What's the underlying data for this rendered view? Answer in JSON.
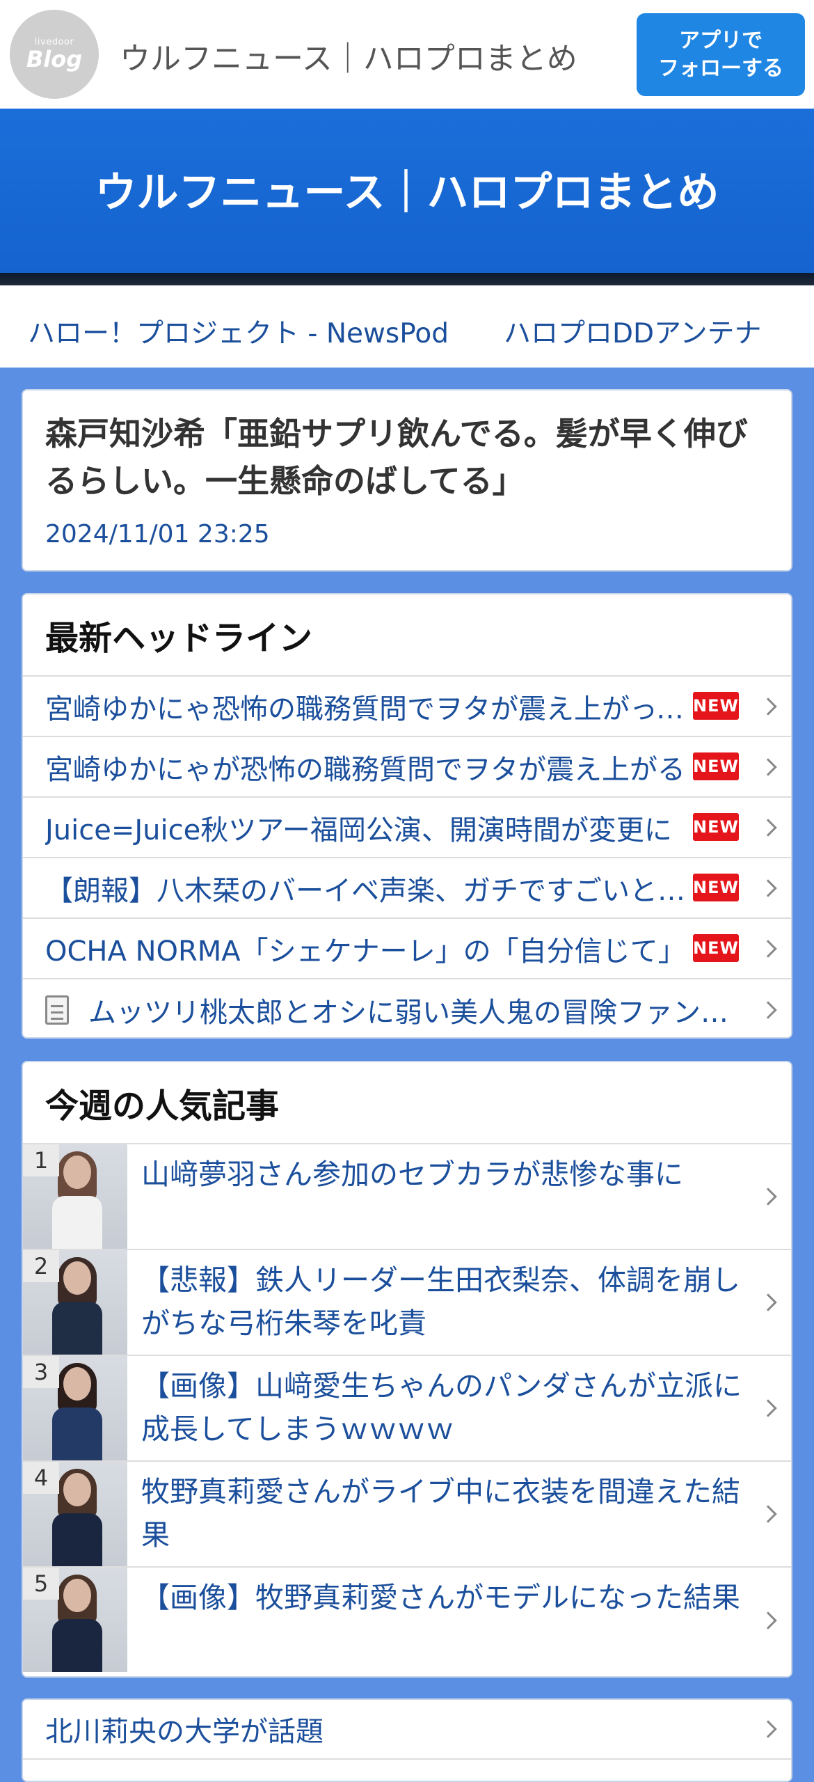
{
  "header": {
    "logo_small": "livedoor",
    "logo_big": "Blog",
    "title": "ウルフニュース｜ハロプロまとめ",
    "follow_line1": "アプリで",
    "follow_line2": "フォローする"
  },
  "hero": {
    "title": "ウルフニュース｜ハロプロまとめ"
  },
  "links": [
    {
      "label": "ハロー！プロジェクト - NewsPod"
    },
    {
      "label": "ハロプロDDアンテナ"
    }
  ],
  "article": {
    "title": "森戸知沙希「亜鉛サプリ飲んでる。髪が早く伸びるらしい。一生懸命のばしてる」",
    "date": "2024/11/01 23:25"
  },
  "headlines": {
    "heading": "最新ヘッドライン",
    "new_label": "NEW",
    "items": [
      {
        "text": "宮崎ゆかにゃ恐怖の職務質問でヲタが震え上がってしまう"
      },
      {
        "text": "宮崎ゆかにゃが恐怖の職務質問でヲタが震え上がる"
      },
      {
        "text": "Juice=Juice秋ツアー福岡公演、開演時間が変更に"
      },
      {
        "text": "【朗報】八木栞のバーイベ声楽、ガチですごいと話題"
      },
      {
        "text": "OCHA NORMA「シェケナーレ」の「自分信じて」"
      },
      {
        "text": "ムッツリ桃太郎とオシに弱い美人鬼の冒険ファンタジー"
      }
    ]
  },
  "popular": {
    "heading": "今週の人気記事",
    "items": [
      {
        "rank": "1",
        "text": "山﨑夢羽さん参加のセブカラが悲惨な事に"
      },
      {
        "rank": "2",
        "text": "【悲報】鉄人リーダー生田衣梨奈、体調を崩しがちな弓桁朱琴を叱責"
      },
      {
        "rank": "3",
        "text": "【画像】山﨑愛生ちゃんのパンダさんが立派に成長してしまうｗｗｗｗ"
      },
      {
        "rank": "4",
        "text": "牧野真莉愛さんがライブ中に衣装を間違えた結果"
      },
      {
        "rank": "5",
        "text": "【画像】牧野真莉愛さんがモデルになった結果"
      }
    ]
  },
  "bottom": {
    "item": "北川莉央の大学が話題"
  },
  "colors": {
    "accent": "#1f86e3",
    "hero": "#1b6ed9",
    "background": "#5b8fe3",
    "link": "#1b4f9c",
    "badge": "#e5161b"
  }
}
